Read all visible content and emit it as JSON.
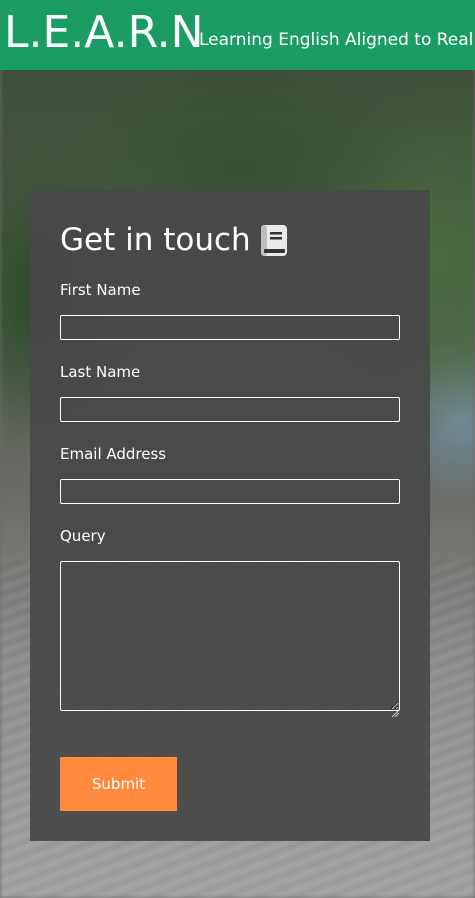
{
  "navbar": {
    "brand": "L.E.A.R.N",
    "tagline": "Learning English Aligned to Real"
  },
  "form": {
    "title": "Get in touch",
    "title_icon": "book-icon",
    "fields": {
      "first_name": {
        "label": "First Name",
        "value": ""
      },
      "last_name": {
        "label": "Last Name",
        "value": ""
      },
      "email": {
        "label": "Email Address",
        "value": ""
      },
      "query": {
        "label": "Query",
        "value": ""
      }
    },
    "submit_label": "Submit"
  },
  "colors": {
    "navbar_bg": "#1b9c63",
    "card_bg": "#484848",
    "submit_bg": "#ff8a3d",
    "text": "#ffffff"
  }
}
